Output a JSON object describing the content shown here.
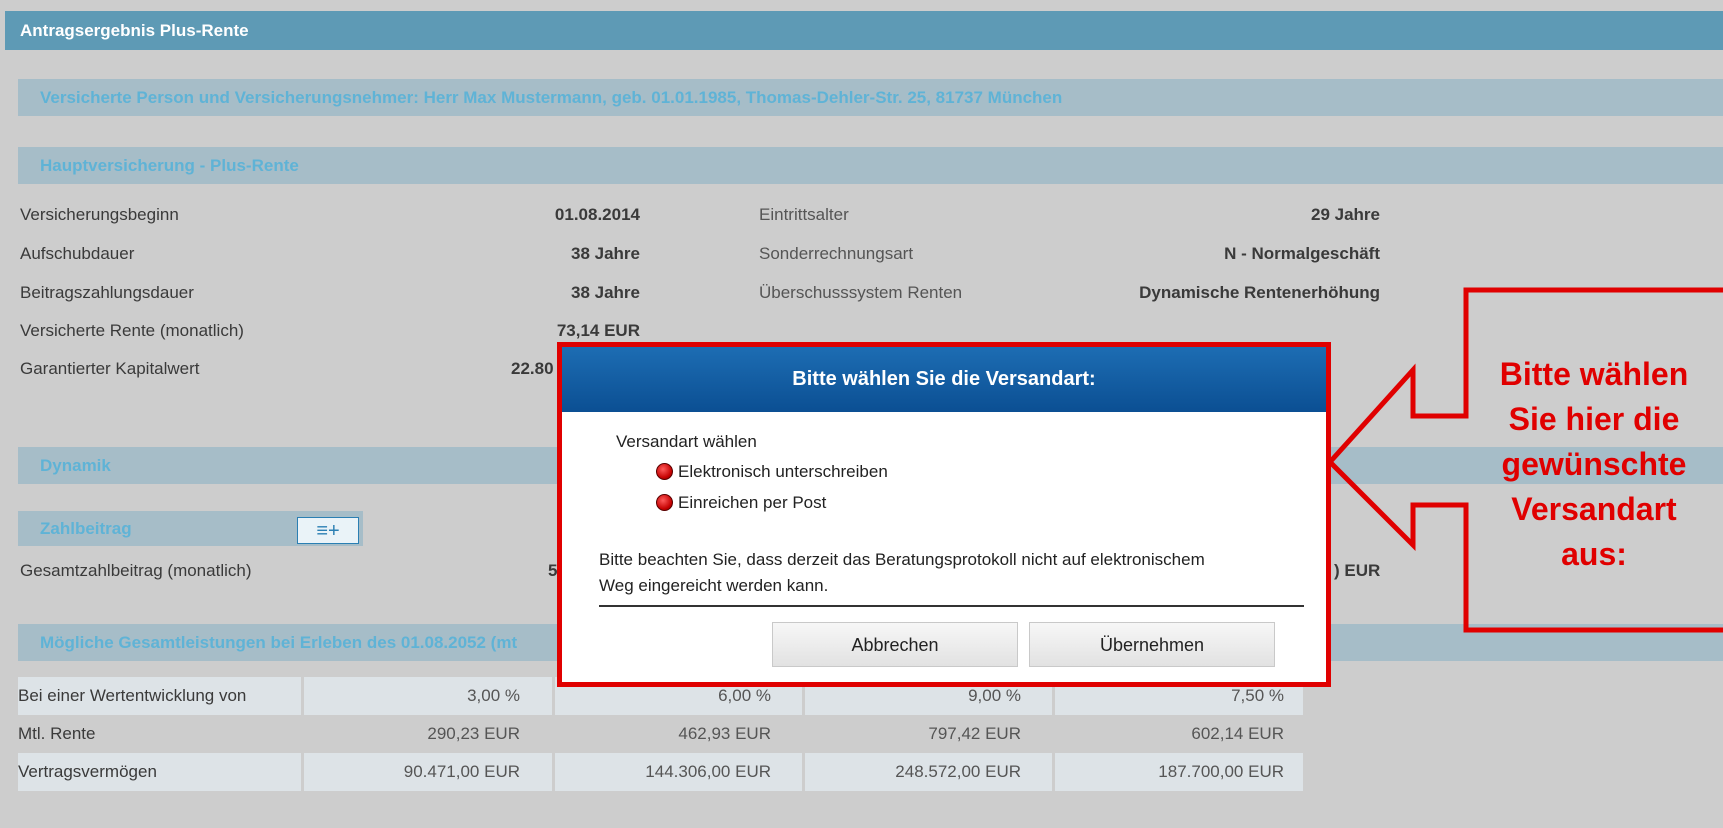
{
  "header": {
    "title": "Antragsergebnis Plus-Rente"
  },
  "person_bar": {
    "text": "Versicherte Person und Versicherungsnehmer: Herr Max Mustermann, geb. 01.01.1985, Thomas-Dehler-Str. 25, 81737 München"
  },
  "haupt": {
    "title": "Hauptversicherung - Plus-Rente",
    "left": [
      {
        "label": "Versicherungsbeginn",
        "value": "01.08.2014"
      },
      {
        "label": "Aufschubdauer",
        "value": "38 Jahre"
      },
      {
        "label": "Beitragszahlungsdauer",
        "value": "38 Jahre"
      },
      {
        "label": "Versicherte Rente (monatlich)",
        "value": "73,14 EUR"
      },
      {
        "label": "Garantierter Kapitalwert",
        "value": "22.80"
      }
    ],
    "right": [
      {
        "label": "Eintrittsalter",
        "value": "29 Jahre"
      },
      {
        "label": "Sonderrechnungsart",
        "value": "N - Normalgeschäft"
      },
      {
        "label": "Überschusssystem Renten",
        "value": "Dynamische Rentenerhöhung"
      }
    ]
  },
  "dynamik": {
    "title": "Dynamik"
  },
  "zahlbeitrag": {
    "title": "Zahlbeitrag",
    "button_glyph": "≡+",
    "row_label": "Gesamtzahlbeitrag (monatlich)",
    "row_value_partial": "5",
    "row_value_right": ") EUR"
  },
  "leistungen": {
    "title": "Mögliche Gesamtleistungen bei Erleben des 01.08.2052 (mt",
    "rows": [
      {
        "label": "Bei einer Wertentwicklung von",
        "values": [
          "3,00 %",
          "6,00 %",
          "9,00 %",
          "7,50 %"
        ]
      },
      {
        "label": "Mtl. Rente",
        "values": [
          "290,23 EUR",
          "462,93 EUR",
          "797,42 EUR",
          "602,14 EUR"
        ]
      },
      {
        "label": "Vertragsvermögen",
        "values": [
          "90.471,00 EUR",
          "144.306,00 EUR",
          "248.572,00 EUR",
          "187.700,00 EUR"
        ]
      }
    ]
  },
  "modal": {
    "title": "Bitte wählen Sie die Versandart:",
    "group_label": "Versandart wählen",
    "options": [
      "Elektronisch unterschreiben",
      "Einreichen per Post"
    ],
    "note_line1": "Bitte beachten Sie, dass derzeit das Beratungsprotokoll nicht auf elektronischem",
    "note_line2": "Weg eingereicht werden kann.",
    "cancel_label": "Abbrechen",
    "accept_label": "Übernehmen"
  },
  "callout": {
    "line1": "Bitte wählen",
    "line2": "Sie hier die",
    "line3": "gewünschte",
    "line4": "Versandart",
    "line5": "aus:"
  },
  "colors": {
    "accent_red": "#e00000",
    "title_bar": "#5e9ab5",
    "modal_header": "#0b4f93",
    "section_text": "#5fb3d6"
  }
}
